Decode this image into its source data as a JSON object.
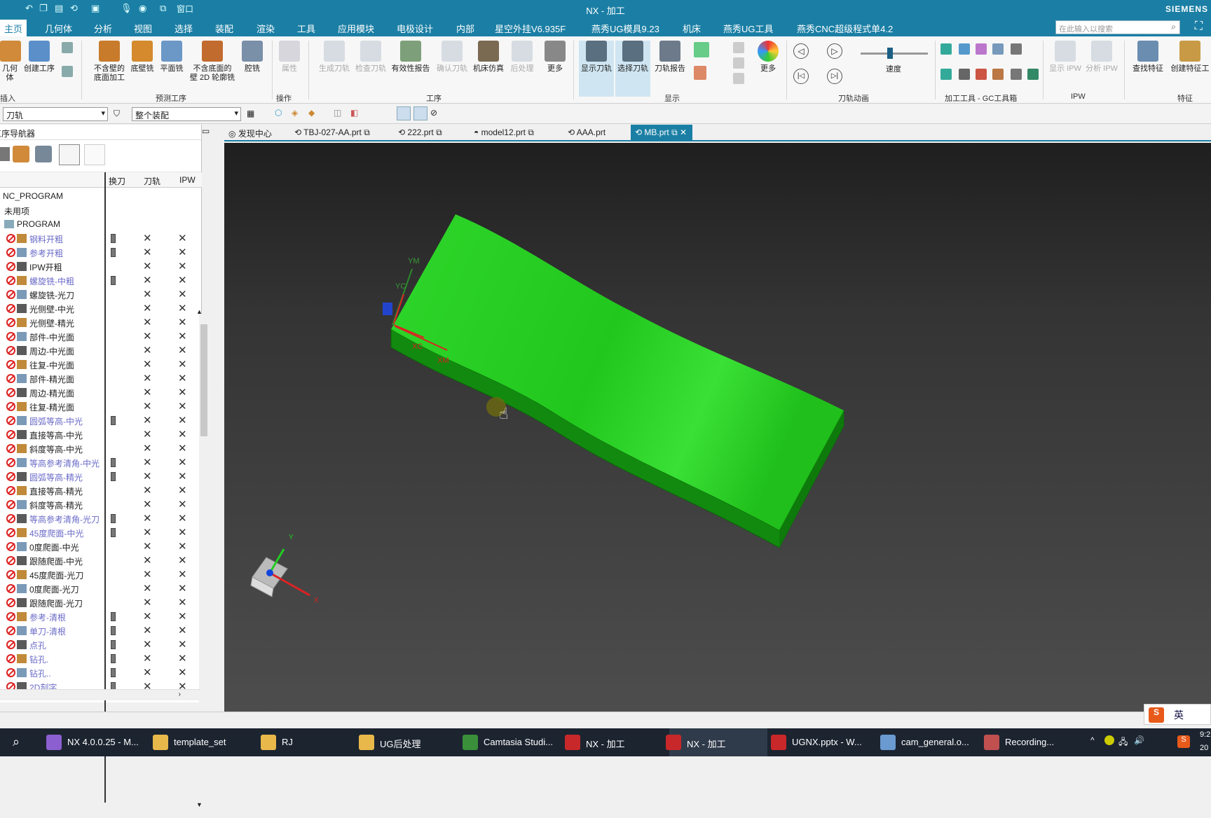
{
  "titlebar": {
    "title": "NX - 加工",
    "brand": "SIEMENS",
    "quick_access_window": "窗口"
  },
  "menu": {
    "tabs": [
      "主页",
      "几何体",
      "分析",
      "视图",
      "选择",
      "装配",
      "渲染",
      "工具",
      "应用模块",
      "电极设计",
      "内部",
      "星空外挂V6.935F",
      "燕秀UG模具9.23",
      "机床",
      "燕秀UG工具",
      "燕秀CNC超级程式单4.2"
    ],
    "active_tab": "主页",
    "search_placeholder": "在此输入以搜索"
  },
  "ribbon": {
    "buttons": {
      "insert_geometry": "几何体",
      "create_operation": "创建工序",
      "floor_wall_ex": "不含壁的\n底面加工",
      "floor_wall": "底壁铣",
      "face_mill": "平面铣",
      "wall_2d": "不含底面的\n壁 2D 轮廓铣",
      "cavity": "腔铣",
      "properties": "属性",
      "gen_path": "生成刀轨",
      "verify_path": "检查刀轨",
      "validity_report": "有效性报告",
      "confirm_path": "确认刀轨",
      "machine_sim": "机床仿真",
      "post_process": "后处理",
      "more1": "更多",
      "show_path": "显示刀轨",
      "select_path": "选择刀轨",
      "path_report": "刀轨报告",
      "more2": "更多",
      "speed_label": "速度",
      "show_ipw": "显示 IPW",
      "analyze_ipw": "分析 IPW",
      "find_feature": "查找特征",
      "create_feature": "创建特征工"
    },
    "groups": {
      "insert": "插入",
      "predefined": "预测工序",
      "operation": "操作",
      "process": "工序",
      "display": "显示",
      "animation": "刀轨动画",
      "gc_tools": "加工工具 - GC工具箱",
      "ipw": "IPW",
      "feature": "特征"
    }
  },
  "toolbar2": {
    "filter": "刀轨",
    "scope": "整个装配"
  },
  "navigator": {
    "title": "工序导航器",
    "columns": [
      "换刀",
      "刀轨",
      "IPW"
    ],
    "root": "NC_PROGRAM",
    "unused": "未用项",
    "program": "PROGRAM",
    "rows": [
      {
        "name": "钢料开粗",
        "blue": true,
        "tool": true
      },
      {
        "name": "参考开粗",
        "blue": true,
        "tool": true
      },
      {
        "name": "IPW开粗",
        "blue": false,
        "tool": false
      },
      {
        "name": "螺旋铣-中粗",
        "blue": true,
        "tool": true
      },
      {
        "name": "螺旋铣-光刀",
        "blue": false,
        "tool": false
      },
      {
        "name": "光侧壁-中光",
        "blue": false,
        "tool": false
      },
      {
        "name": "光侧壁-精光",
        "blue": false,
        "tool": false
      },
      {
        "name": "部件-中光面",
        "blue": false,
        "tool": false
      },
      {
        "name": "周边-中光面",
        "blue": false,
        "tool": false
      },
      {
        "name": "往复-中光面",
        "blue": false,
        "tool": false
      },
      {
        "name": "部件-精光面",
        "blue": false,
        "tool": false
      },
      {
        "name": "周边-精光面",
        "blue": false,
        "tool": false
      },
      {
        "name": "往复-精光面",
        "blue": false,
        "tool": false
      },
      {
        "name": "圆弧等高-中光",
        "blue": true,
        "tool": true
      },
      {
        "name": "直接等高-中光",
        "blue": false,
        "tool": false
      },
      {
        "name": "斜度等高-中光",
        "blue": false,
        "tool": false
      },
      {
        "name": "等高参考清角-中光",
        "blue": true,
        "tool": true
      },
      {
        "name": "圆弧等高-精光",
        "blue": true,
        "tool": true
      },
      {
        "name": "直接等高-精光",
        "blue": false,
        "tool": false
      },
      {
        "name": "斜度等高-精光",
        "blue": false,
        "tool": false
      },
      {
        "name": "等高参考清角-光刀",
        "blue": true,
        "tool": true
      },
      {
        "name": "45度爬面-中光",
        "blue": true,
        "tool": true
      },
      {
        "name": "0度爬面-中光",
        "blue": false,
        "tool": false
      },
      {
        "name": "跟随爬面-中光",
        "blue": false,
        "tool": false
      },
      {
        "name": "45度爬面-光刀",
        "blue": false,
        "tool": false
      },
      {
        "name": "0度爬面-光刀",
        "blue": false,
        "tool": false
      },
      {
        "name": "跟随爬面-光刀",
        "blue": false,
        "tool": false
      },
      {
        "name": "参考-清根",
        "blue": true,
        "tool": true
      },
      {
        "name": "单刀-清根",
        "blue": true,
        "tool": true
      },
      {
        "name": "点孔",
        "blue": true,
        "tool": true
      },
      {
        "name": "钻孔.",
        "blue": true,
        "tool": true
      },
      {
        "name": "钻孔..",
        "blue": true,
        "tool": true
      },
      {
        "name": "2D刻字",
        "blue": true,
        "tool": true
      }
    ]
  },
  "doc_tabs": [
    "发现中心",
    "TBJ-027-AA.prt",
    "222.prt",
    "model12.prt",
    "AAA.prt",
    "MB.prt"
  ],
  "active_doc": "MB.prt",
  "viewport": {
    "axis_labels": {
      "ym": "YM",
      "yc": "YC",
      "xc": "XC",
      "xm": "XM",
      "y": "Y",
      "x": "X"
    },
    "part_color": "#22c71e"
  },
  "ime": {
    "label": "英"
  },
  "taskbar": {
    "items": [
      "NX 4.0.0.25 - M...",
      "template_set",
      "RJ",
      "UG后处理",
      "Camtasia Studi...",
      "NX - 加工",
      "NX - 加工",
      "UGNX.pptx - W...",
      "cam_general.o...",
      "Recording..."
    ],
    "clock_time": "9:2",
    "clock_date": "20"
  }
}
